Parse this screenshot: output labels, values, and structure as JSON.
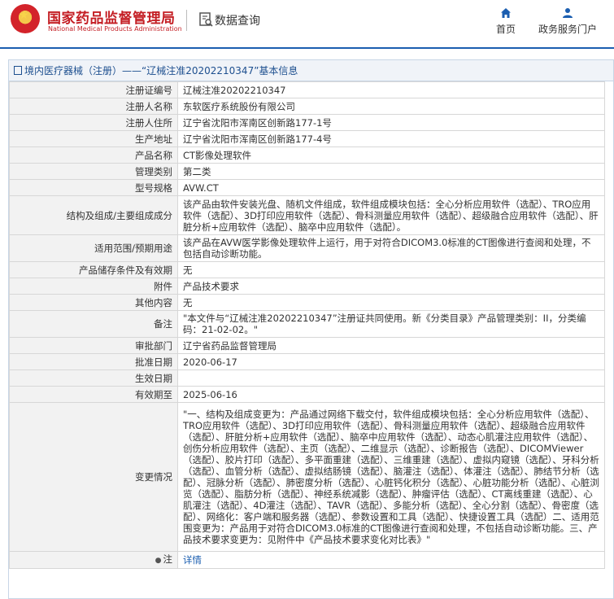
{
  "header": {
    "org_name_cn": "国家药品监督管理局",
    "org_name_en": "National Medical Products Administration",
    "query_label": "数据查询",
    "nav": [
      {
        "label": "首页",
        "icon": "home-icon"
      },
      {
        "label": "政务服务门户",
        "icon": "user-icon"
      }
    ]
  },
  "breadcrumb": {
    "text": "境内医疗器械（注册）——“辽械注准20202210347”基本信息"
  },
  "fields": [
    {
      "key": "注册证编号",
      "value": "辽械注准20202210347"
    },
    {
      "key": "注册人名称",
      "value": "东软医疗系统股份有限公司"
    },
    {
      "key": "注册人住所",
      "value": "辽宁省沈阳市浑南区创新路177-1号"
    },
    {
      "key": "生产地址",
      "value": "辽宁省沈阳市浑南区创新路177-4号"
    },
    {
      "key": "产品名称",
      "value": "CT影像处理软件"
    },
    {
      "key": "管理类别",
      "value": "第二类"
    },
    {
      "key": "型号规格",
      "value": "AVW.CT"
    },
    {
      "key": "结构及组成/主要组成成分",
      "value": "该产品由软件安装光盘、随机文件组成，软件组成模块包括：全心分析应用软件（选配）、TRO应用软件（选配）、3D打印应用软件（选配）、骨科测量应用软件（选配）、超级融合应用软件（选配）、肝脏分析+应用软件（选配）、脑卒中应用软件（选配）。"
    },
    {
      "key": "适用范围/预期用途",
      "value": "该产品在AVW医学影像处理软件上运行，用于对符合DICOM3.0标准的CT图像进行查阅和处理，不包括自动诊断功能。"
    },
    {
      "key": "产品储存条件及有效期",
      "value": "无"
    },
    {
      "key": "附件",
      "value": "产品技术要求"
    },
    {
      "key": "其他内容",
      "value": "无"
    },
    {
      "key": "备注",
      "value": "\"本文件与“辽械注准20202210347”注册证共同使用。新《分类目录》产品管理类别：II，分类编码：21-02-02。\""
    },
    {
      "key": "审批部门",
      "value": "辽宁省药品监督管理局"
    },
    {
      "key": "批准日期",
      "value": "2020-06-17"
    },
    {
      "key": "生效日期",
      "value": ""
    },
    {
      "key": "有效期至",
      "value": "2025-06-16"
    },
    {
      "key": "变更情况",
      "value": "\"一、结构及组成变更为：产品通过网络下载交付，软件组成模块包括：全心分析应用软件（选配）、TRO应用软件（选配）、3D打印应用软件（选配）、骨科测量应用软件（选配）、超级融合应用软件（选配）、肝脏分析+应用软件（选配）、脑卒中应用软件（选配）、动态心肌灌注应用软件（选配）、创伤分析应用软件（选配）、主页（选配）、二维显示（选配）、诊断报告（选配）、DICOMViewer（选配）、胶片打印（选配）、多平面重建（选配）、三维重建（选配）、虚拟内窥镜（选配）、牙科分析（选配）、血管分析（选配）、虚拟结肠镜（选配）、脑灌注（选配）、体灌注（选配）、肺结节分析（选配）、冠脉分析（选配）、肺密度分析（选配）、心脏钙化积分（选配）、心脏功能分析（选配）、心脏浏览（选配）、脂肪分析（选配）、神经系统减影（选配）、肿瘤评估（选配）、CT离线重建（选配）、心肌灌注（选配）、4D灌注（选配）、TAVR（选配）、多能分析（选配）、全心分割（选配）、骨密度（选配）、网络化：客户端和服务器（选配）、参数设置和工具（选配）、快捷设置工具（选配）二、适用范围变更为：产品用于对符合DICOM3.0标准的CT图像进行查阅和处理，不包括自动诊断功能。三、产品技术要求变更为：见附件中《产品技术要求变化对比表》\""
    }
  ],
  "note": {
    "key": "注",
    "value": "详情",
    "icon": "bulb-icon"
  }
}
